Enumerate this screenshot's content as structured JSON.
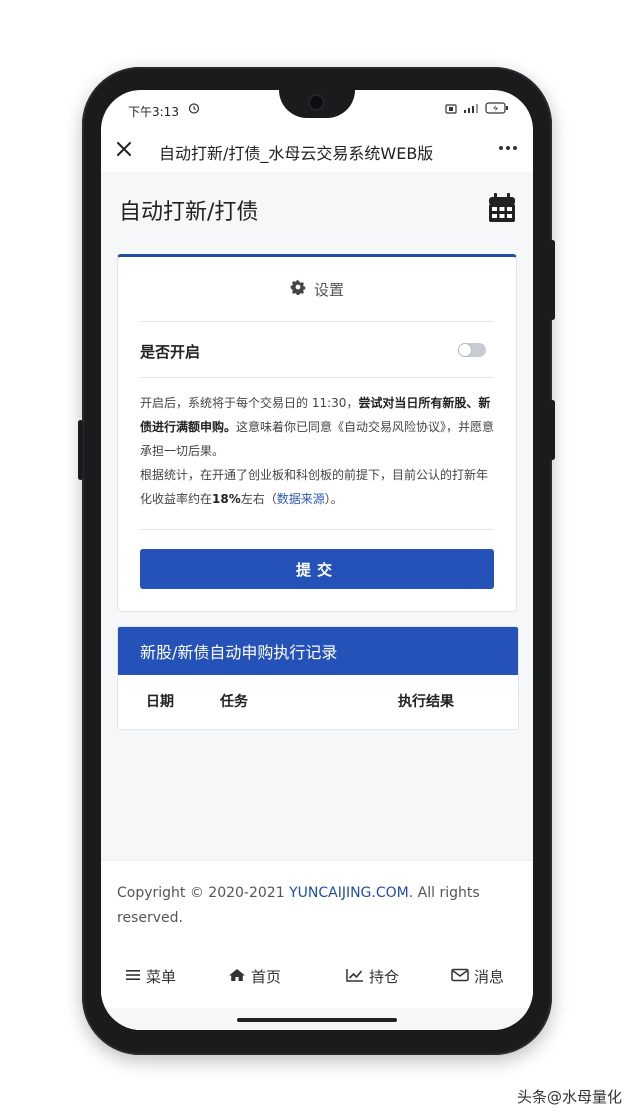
{
  "status_bar": {
    "time": "下午3:13"
  },
  "title_bar": {
    "title": "自动打新/打债_水母云交易系统WEB版"
  },
  "page": {
    "title": "自动打新/打债"
  },
  "settings_card": {
    "header": "设置",
    "toggle_label": "是否开启",
    "toggle_on": false,
    "desc_1": "开启后，系统将于每个交易日的 11:30，",
    "desc_1_bold": "尝试对当日所有新股、新债进行满额申购。",
    "desc_2": "这意味着你已同意《自动交易风险协议》，并愿意承担一切后果。",
    "desc_3": "根据统计，在开通了创业板和科创板的前提下，目前公认的打新年化收益率约在",
    "desc_3_bold": "18%",
    "desc_3_tail": "左右（",
    "desc_link": "数据来源",
    "desc_end": "）。",
    "submit_label": "提交"
  },
  "records": {
    "header": "新股/新债自动申购执行记录",
    "columns": [
      "日期",
      "任务",
      "执行结果"
    ]
  },
  "footer": {
    "copyright_prefix": "Copyright © 2020-2021 ",
    "brand": "YUNCAIJING.COM",
    "copyright_suffix": ". All rights reserved."
  },
  "tabbar": {
    "menu": "菜单",
    "home": "首页",
    "holdings": "持仓",
    "messages": "消息"
  },
  "watermark": "头条@水母量化",
  "colors": {
    "primary": "#2552b9",
    "link": "#1f4ea8"
  }
}
